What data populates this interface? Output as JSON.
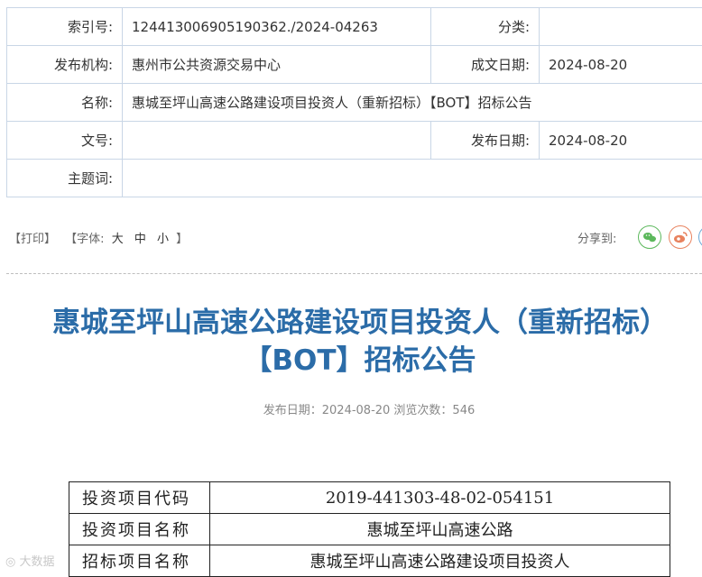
{
  "meta": {
    "index_label": "索引号:",
    "index_value": "124413006905190362./2024-04263",
    "category_label": "分类:",
    "category_value": "",
    "org_label": "发布机构:",
    "org_value": "惠州市公共资源交易中心",
    "written_label": "成文日期:",
    "written_value": "2024-08-20",
    "name_label": "名称:",
    "name_value": "惠城至坪山高速公路建设项目投资人（重新招标）【BOT】招标公告",
    "docno_label": "文号:",
    "docno_value": "",
    "pubdate_label": "发布日期:",
    "pubdate_value": "2024-08-20",
    "topic_label": "主题词:",
    "topic_value": ""
  },
  "toolbar": {
    "print": "【打印】",
    "font_open": "【字体:",
    "font_large": "大",
    "font_medium": "中",
    "font_small": "小",
    "font_close": "】",
    "share_label": "分享到:"
  },
  "article": {
    "title_line1": "惠城至坪山高速公路建设项目投资人（重新招标）",
    "title_line2": "【BOT】招标公告",
    "pubinfo": "发布日期：2024-08-20  浏览次数：546"
  },
  "info_table": [
    {
      "key": "投资项目代码",
      "value": "2019-441303-48-02-054151"
    },
    {
      "key": "投资项目名称",
      "value": "惠城至坪山高速公路"
    },
    {
      "key": "招标项目名称",
      "value": "惠城至坪山高速公路建设项目投资人"
    }
  ],
  "watermark": "大数据"
}
